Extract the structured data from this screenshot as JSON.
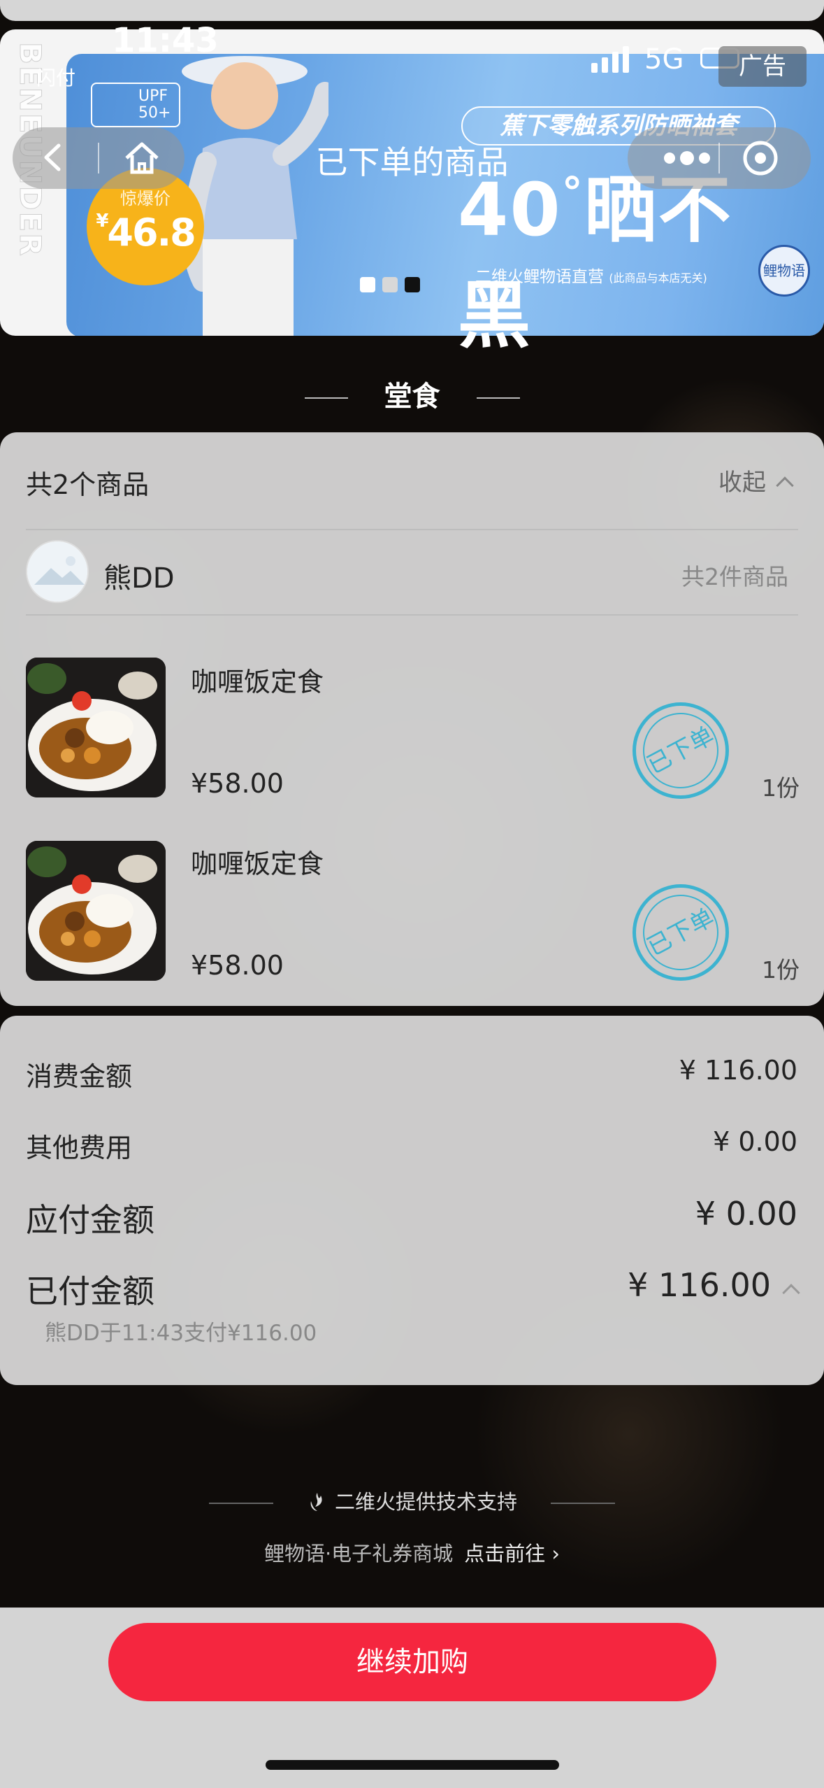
{
  "status_bar": {
    "time": "11:43",
    "app_hint": "闪付",
    "network": "5G"
  },
  "banner": {
    "ad_label": "广告",
    "brand_vertical": "BENEUNDER",
    "uv_label": "UPF 50+",
    "price_label": "惊爆价",
    "price_currency": "¥",
    "price_value": "46.8",
    "slogan_pill": "蕉下零触系列防晒袖套",
    "slogan_big": "40",
    "slogan_big_unit": "°",
    "slogan_big_tail": "晒不黑",
    "brand_line": "二维火鲤物语直营",
    "brand_note": "(此商品与本店无关)",
    "brand_seal": "鲤物语"
  },
  "header": {
    "title": "已下单的商品"
  },
  "section": {
    "label": "堂食"
  },
  "order": {
    "summary": "共2个商品",
    "collapse_label": "收起",
    "store": {
      "name": "熊DD",
      "count": "共2件商品"
    },
    "items": [
      {
        "name": "咖喱饭定食",
        "price": "¥58.00",
        "qty": "1份",
        "stamp": "已下单"
      },
      {
        "name": "咖喱饭定食",
        "price": "¥58.00",
        "qty": "1份",
        "stamp": "已下单"
      }
    ]
  },
  "payment": {
    "rows": [
      {
        "label": "消费金额",
        "value": "¥ 116.00"
      },
      {
        "label": "其他费用",
        "value": "¥ 0.00"
      },
      {
        "label": "应付金额",
        "value": "¥ 0.00"
      },
      {
        "label": "已付金额",
        "value": "¥ 116.00"
      }
    ],
    "paid_detail": "熊DD于11:43支付¥116.00"
  },
  "footer": {
    "tech_support": "二维火提供技术支持",
    "mall_text": "鲤物语·电子礼券商城",
    "mall_link": "点击前往 ›"
  },
  "cta": {
    "label": "继续加购"
  },
  "colors": {
    "accent": "#f5263f",
    "stamp": "#3db3d0",
    "banner_blue": "#6aa6e6"
  }
}
